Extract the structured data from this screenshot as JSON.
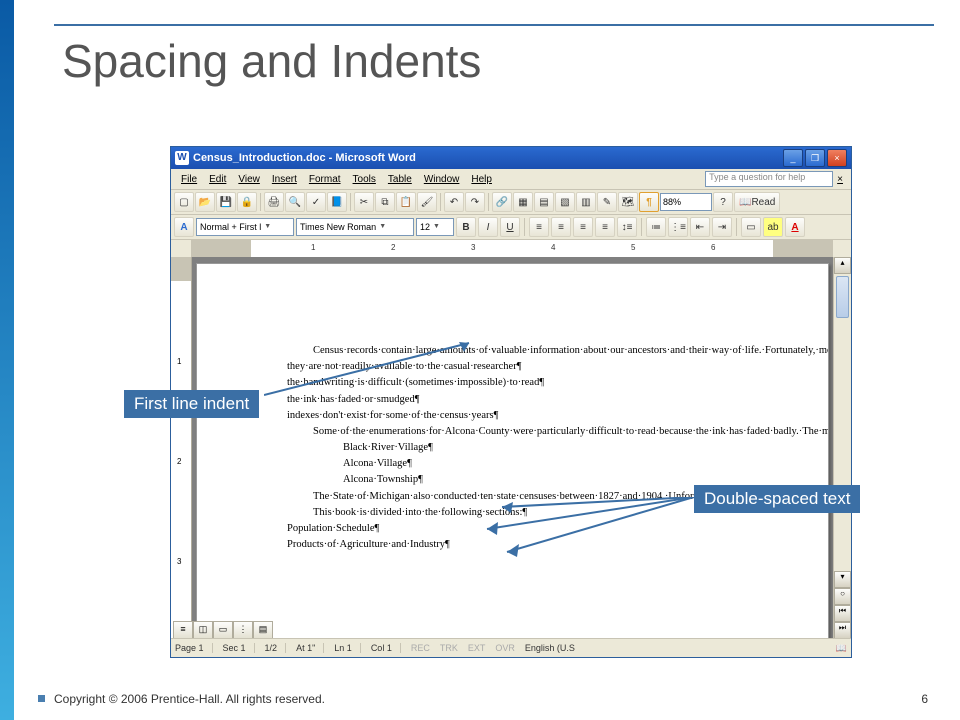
{
  "slide": {
    "title": "Spacing and Indents",
    "copyright": "Copyright © 2006 Prentice-Hall. All rights reserved.",
    "page_number": "6"
  },
  "callouts": {
    "first_line": "First line indent",
    "double_space": "Double-spaced text"
  },
  "word": {
    "titlebar": "Census_Introduction.doc - Microsoft Word",
    "menus": [
      "File",
      "Edit",
      "View",
      "Insert",
      "Format",
      "Tools",
      "Table",
      "Window",
      "Help"
    ],
    "help_placeholder": "Type a question for help",
    "zoom": "88%",
    "read_label": "Read",
    "style": "Normal + First l",
    "font": "Times New Roman",
    "size": "12",
    "ruler_ticks": [
      "1",
      "2",
      "3",
      "4",
      "5",
      "6"
    ],
    "vruler": [
      "1",
      "2",
      "3"
    ],
    "status": {
      "page": "Page 1",
      "sec": "Sec 1",
      "pages": "1/2",
      "at": "At 1\"",
      "ln": "Ln 1",
      "col": "Col 1",
      "modes": [
        "REC",
        "TRK",
        "EXT",
        "OVR"
      ],
      "lang": "English (U.S"
    },
    "doc": {
      "p1": "Census·records·contain·large·amounts·of·valuable·information·about·our·ancestors·and·their·way·of·life.·Fortunately,·most·of·the·actual·census·records·(through·1930)·are·available·on·microfilm.·Some·of·the·original·census·books·can·be·accessed,·if·a·researcher·knows·where·to·look·for·them.·The·problem·with·these·records·is·that:¶",
      "b1": "they·are·not·readily·available·to·the·casual·researcher¶",
      "b2": "the·handwriting·is·difficult·(sometimes·impossible)·to·read¶",
      "b3": "the·ink·has·faded·or·smudged¶",
      "b4": "indexes·don't·exist·for·some·of·the·census·years¶",
      "p2": "Some·of·the·enumerations·for·Alcona·County·were·particularly·difficult·to·read·because·the·ink·has·faded·badly.·The·most·challenging·were:¶",
      "l1": "Black·River·Village¶",
      "l2": "Alcona·Village¶",
      "l3": "Alcona·Township¶",
      "p3": "The·State·of·Michigan·also·conducted·ten·state·censuses·between·1827·and·1904.·Unfortunately,·none·of·these·records·have·survived·for·Alcona·County.¶",
      "p4": "This·book·is·divided·into·the·following·sections:¶",
      "p5": "Population·Schedule¶",
      "p6": "Products·of·Agriculture·and·Industry¶"
    }
  }
}
